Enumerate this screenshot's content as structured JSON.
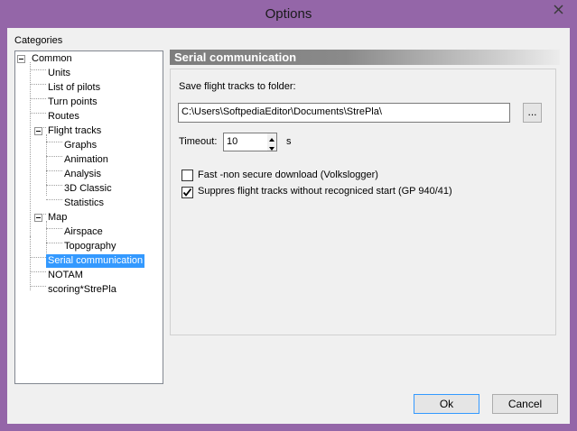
{
  "window": {
    "title": "Options"
  },
  "categories_label": "Categories",
  "tree": [
    {
      "label": "Common"
    },
    {
      "label": "Units"
    },
    {
      "label": "List of pilots"
    },
    {
      "label": "Turn points"
    },
    {
      "label": "Routes"
    },
    {
      "label": "Flight tracks"
    },
    {
      "label": "Graphs"
    },
    {
      "label": "Animation"
    },
    {
      "label": "Analysis"
    },
    {
      "label": "3D Classic"
    },
    {
      "label": "Statistics"
    },
    {
      "label": "Map"
    },
    {
      "label": "Airspace"
    },
    {
      "label": "Topography"
    },
    {
      "label": "Serial communication",
      "selected": true
    },
    {
      "label": "NOTAM"
    },
    {
      "label": "scoring*StrePla"
    }
  ],
  "section": {
    "title": "Serial communication"
  },
  "folder": {
    "label": "Save flight tracks to folder:",
    "value": "C:\\Users\\SoftpediaEditor\\Documents\\StrePla\\",
    "browse": "..."
  },
  "timeout": {
    "label": "Timeout:",
    "value": "10",
    "unit": "s"
  },
  "options": [
    {
      "label": "Fast -non secure download (Volkslogger)",
      "checked": false
    },
    {
      "label": "Suppres flight tracks without recogniced start (GP 940/41)",
      "checked": true
    }
  ],
  "buttons": {
    "ok": "Ok",
    "cancel": "Cancel"
  }
}
